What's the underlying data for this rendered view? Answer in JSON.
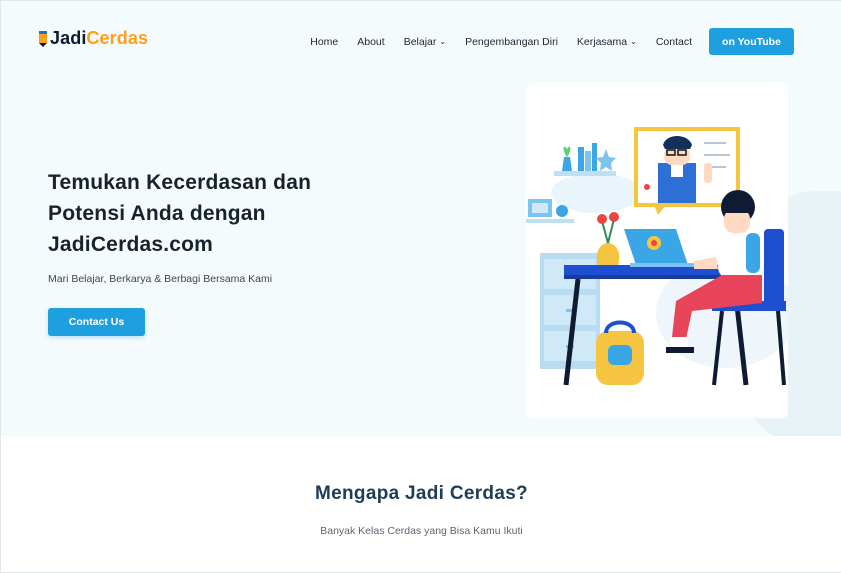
{
  "brand": {
    "name_prefix": "Jadi",
    "name_suffix": "Cerdas"
  },
  "nav": {
    "items": [
      {
        "label": "Home",
        "has_dropdown": false
      },
      {
        "label": "About",
        "has_dropdown": false
      },
      {
        "label": "Belajar",
        "has_dropdown": true
      },
      {
        "label": "Pengembangan Diri",
        "has_dropdown": false
      },
      {
        "label": "Kerjasama",
        "has_dropdown": true
      },
      {
        "label": "Contact",
        "has_dropdown": false
      }
    ],
    "youtube_button": "on YouTube"
  },
  "hero": {
    "title": "Temukan Kecerdasan dan Potensi Anda dengan JadiCerdas.com",
    "subtitle": "Mari Belajar, Berkarya & Berbagi Bersama Kami",
    "cta_label": "Contact Us"
  },
  "section": {
    "title": "Mengapa Jadi Cerdas?",
    "subtitle": "Banyak Kelas Cerdas yang Bisa Kamu Ikuti"
  },
  "colors": {
    "accent": "#1ea0e0",
    "brand_orange": "#ff9f1c",
    "heading_dark": "#18222c",
    "section_heading": "#1d3d59",
    "hero_bg": "#f4fbfd"
  },
  "icons": {
    "logo": "pencil-icon",
    "dropdown": "chevron-down-icon"
  }
}
